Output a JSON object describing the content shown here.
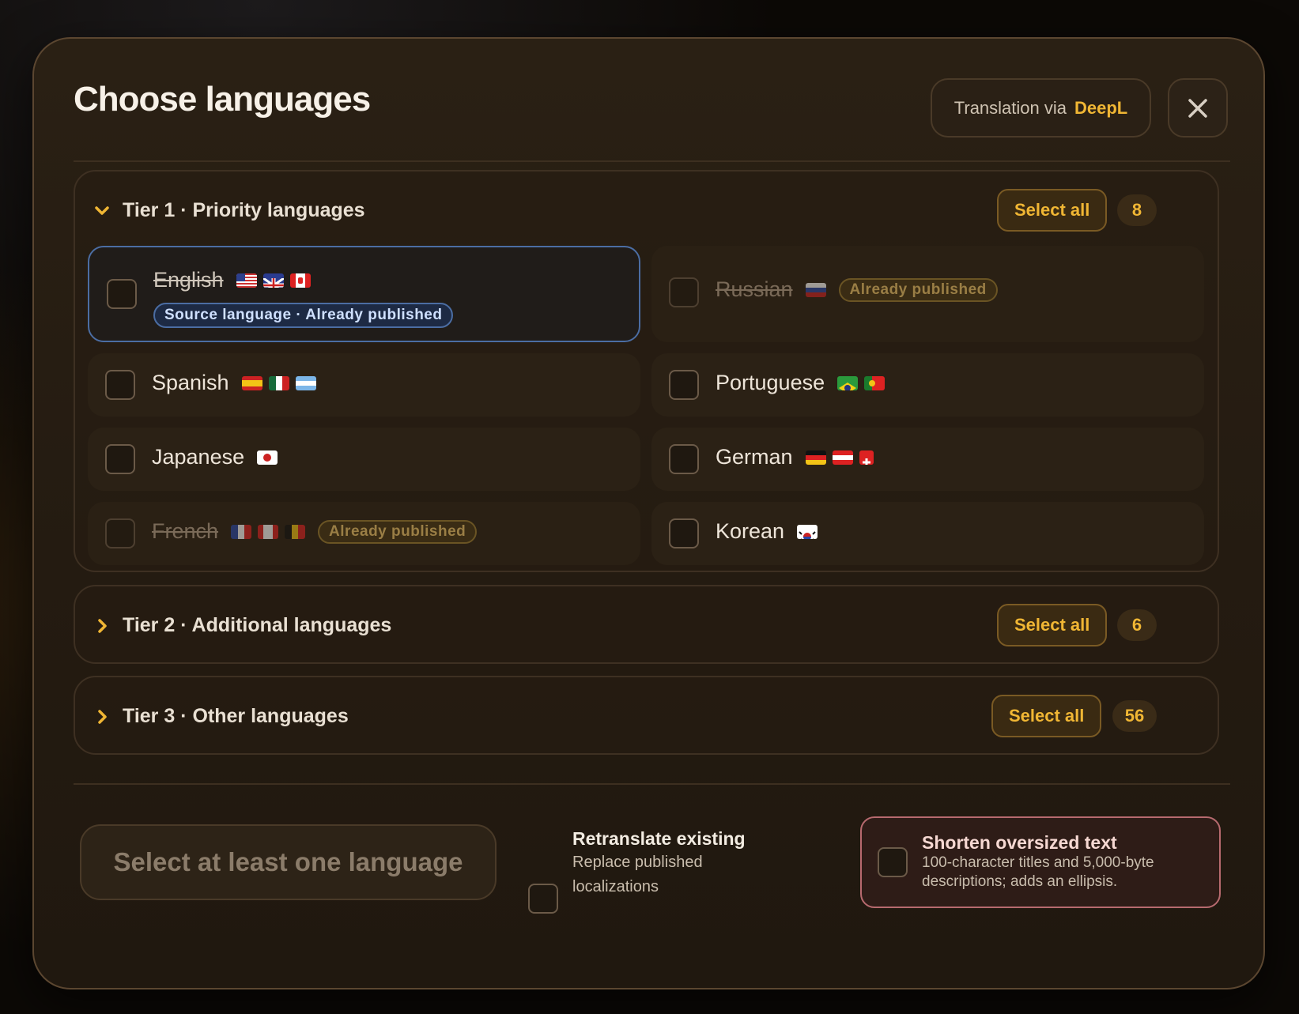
{
  "dialog": {
    "title": "Choose languages",
    "provider_prefix": "Translation via",
    "provider_brand": "DeepL",
    "close_icon": "close-icon"
  },
  "tiers": [
    {
      "title": "Tier 1 · Priority languages",
      "expanded": true,
      "select_all_label": "Select all",
      "count": "8",
      "languages": [
        {
          "name": "English",
          "flags": [
            "us",
            "gb",
            "ca"
          ],
          "badge": "Source language · Already published",
          "state": "source"
        },
        {
          "name": "Russian",
          "flags": [
            "ru"
          ],
          "badge": "Already published",
          "state": "published"
        },
        {
          "name": "Spanish",
          "flags": [
            "es",
            "mx",
            "ar"
          ],
          "badge": "",
          "state": "available"
        },
        {
          "name": "Portuguese",
          "flags": [
            "br",
            "pt"
          ],
          "badge": "",
          "state": "available"
        },
        {
          "name": "Japanese",
          "flags": [
            "jp"
          ],
          "badge": "",
          "state": "available"
        },
        {
          "name": "German",
          "flags": [
            "de",
            "at",
            "ch"
          ],
          "badge": "",
          "state": "available"
        },
        {
          "name": "French",
          "flags": [
            "fr",
            "ca",
            "be"
          ],
          "badge": "Already published",
          "state": "published"
        },
        {
          "name": "Korean",
          "flags": [
            "kr"
          ],
          "badge": "",
          "state": "available"
        }
      ]
    },
    {
      "title": "Tier 2 · Additional languages",
      "expanded": false,
      "select_all_label": "Select all",
      "count": "6"
    },
    {
      "title": "Tier 3 · Other languages",
      "expanded": false,
      "select_all_label": "Select all",
      "count": "56"
    }
  ],
  "footer": {
    "submit_label": "Select at least one language",
    "retranslate": {
      "title": "Retranslate existing",
      "desc_line1": "Replace published",
      "desc_line2": "localizations",
      "checked": false
    },
    "shorten": {
      "title": "Shorten oversized text",
      "desc_line1": "100-character titles and 5,000-byte",
      "desc_line2": "descriptions; adds an ellipsis.",
      "checked": false
    }
  },
  "colors": {
    "accent": "#f0b634",
    "source_blue": "#4b6da3",
    "warning_border": "#b76a6f"
  }
}
